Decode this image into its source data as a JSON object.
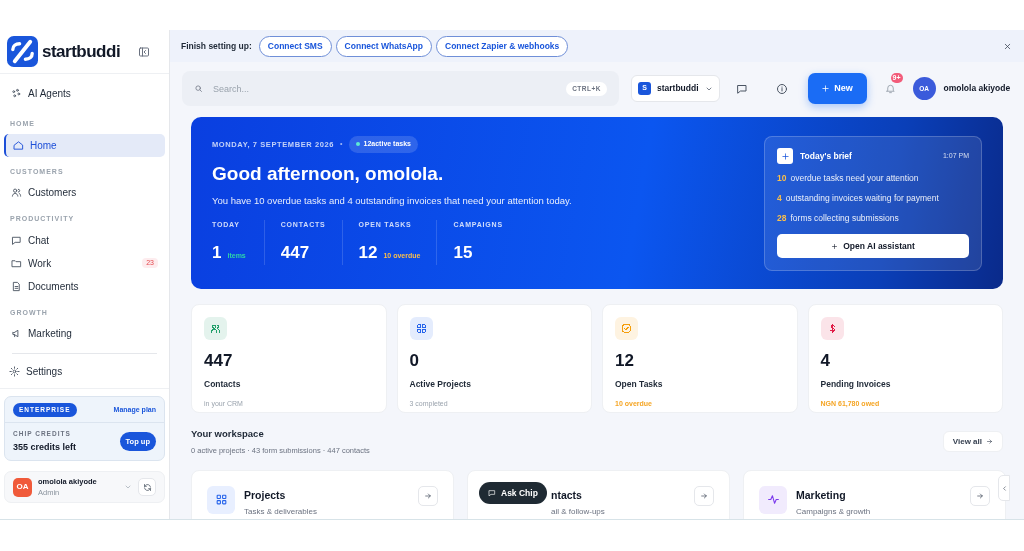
{
  "sidebar": {
    "brand": "startbuddi",
    "ai_agents": "AI Agents",
    "sections": [
      {
        "heading": "HOME",
        "items": [
          {
            "label": "Home",
            "selected": true
          }
        ]
      },
      {
        "heading": "CUSTOMERS",
        "items": [
          {
            "label": "Customers",
            "selected": false
          }
        ]
      },
      {
        "heading": "PRODUCTIVITY",
        "items": [
          {
            "label": "Chat",
            "selected": false
          },
          {
            "label": "Work",
            "selected": false,
            "badge": "23"
          },
          {
            "label": "Documents",
            "selected": false
          }
        ]
      },
      {
        "heading": "GROWTH",
        "items": [
          {
            "label": "Marketing",
            "selected": false
          }
        ]
      }
    ],
    "settings": "Settings",
    "plan": {
      "tier": "ENTERPRISE",
      "manage": "Manage plan",
      "credits_label": "CHIP CREDITS",
      "credits": "355 credits left",
      "top_up": "Top up"
    },
    "user": {
      "initials": "OA",
      "name": "omolola akiyode",
      "role": "Admin"
    }
  },
  "banner": {
    "label": "Finish setting up:",
    "actions": [
      "Connect SMS",
      "Connect WhatsApp",
      "Connect Zapier & webhooks"
    ]
  },
  "header": {
    "search_placeholder": "Search...",
    "shortcut": "CTRL+K",
    "workspace": {
      "initial": "S",
      "name": "startbuddi"
    },
    "new_button": "New",
    "notification_badge": "9+",
    "user": {
      "initials": "OA",
      "name": "omolola akiyode"
    }
  },
  "hero": {
    "date": "MONDAY, 7 SEPTEMBER 2026",
    "separator": "•",
    "pill": "12active tasks",
    "greeting": "Good afternoon, omolola.",
    "message": "You have 10 overdue tasks and 4 outstanding invoices that need your attention today.",
    "stats": [
      {
        "label": "TODAY",
        "value": "1",
        "note": "items",
        "color": "#2dd4a8"
      },
      {
        "label": "CONTACTS",
        "value": "447"
      },
      {
        "label": "OPEN TASKS",
        "value": "12",
        "note": "10 overdue",
        "color": "#fbbf4a"
      },
      {
        "label": "CAMPAIGNS",
        "value": "15"
      }
    ],
    "brief": {
      "title": "Today's brief",
      "time": "1:07 PM",
      "items": [
        {
          "count": "10",
          "text": "overdue tasks need your attention"
        },
        {
          "count": "4",
          "text": "outstanding invoices waiting for payment"
        },
        {
          "count": "28",
          "text": "forms collecting submissions"
        }
      ],
      "button": "Open AI assistant"
    }
  },
  "stat_cards": [
    {
      "value": "447",
      "label": "Contacts",
      "note": "in your CRM",
      "highlight": false,
      "color": "#22a06b"
    },
    {
      "value": "0",
      "label": "Active Projects",
      "note": "3 completed",
      "highlight": false,
      "color": "#2563eb"
    },
    {
      "value": "12",
      "label": "Open Tasks",
      "note": "10 overdue",
      "highlight": true,
      "color": "#f59e0b"
    },
    {
      "value": "4",
      "label": "Pending Invoices",
      "note": "NGN 61,780 owed",
      "highlight": true,
      "color": "#e11d48"
    }
  ],
  "workspace": {
    "title": "Your workspace",
    "summary": "0 active projects · 43 form submissions · 447 contacts",
    "view_all": "View all",
    "modules": [
      {
        "title": "Projects",
        "subtitle": "Tasks & deliverables",
        "covered": false
      },
      {
        "title": "ntacts",
        "subtitle": "ail & follow-ups",
        "covered": true
      },
      {
        "title": "Marketing",
        "subtitle": "Campaigns & growth",
        "covered": false
      }
    ]
  },
  "ask_chip": "Ask Chip"
}
